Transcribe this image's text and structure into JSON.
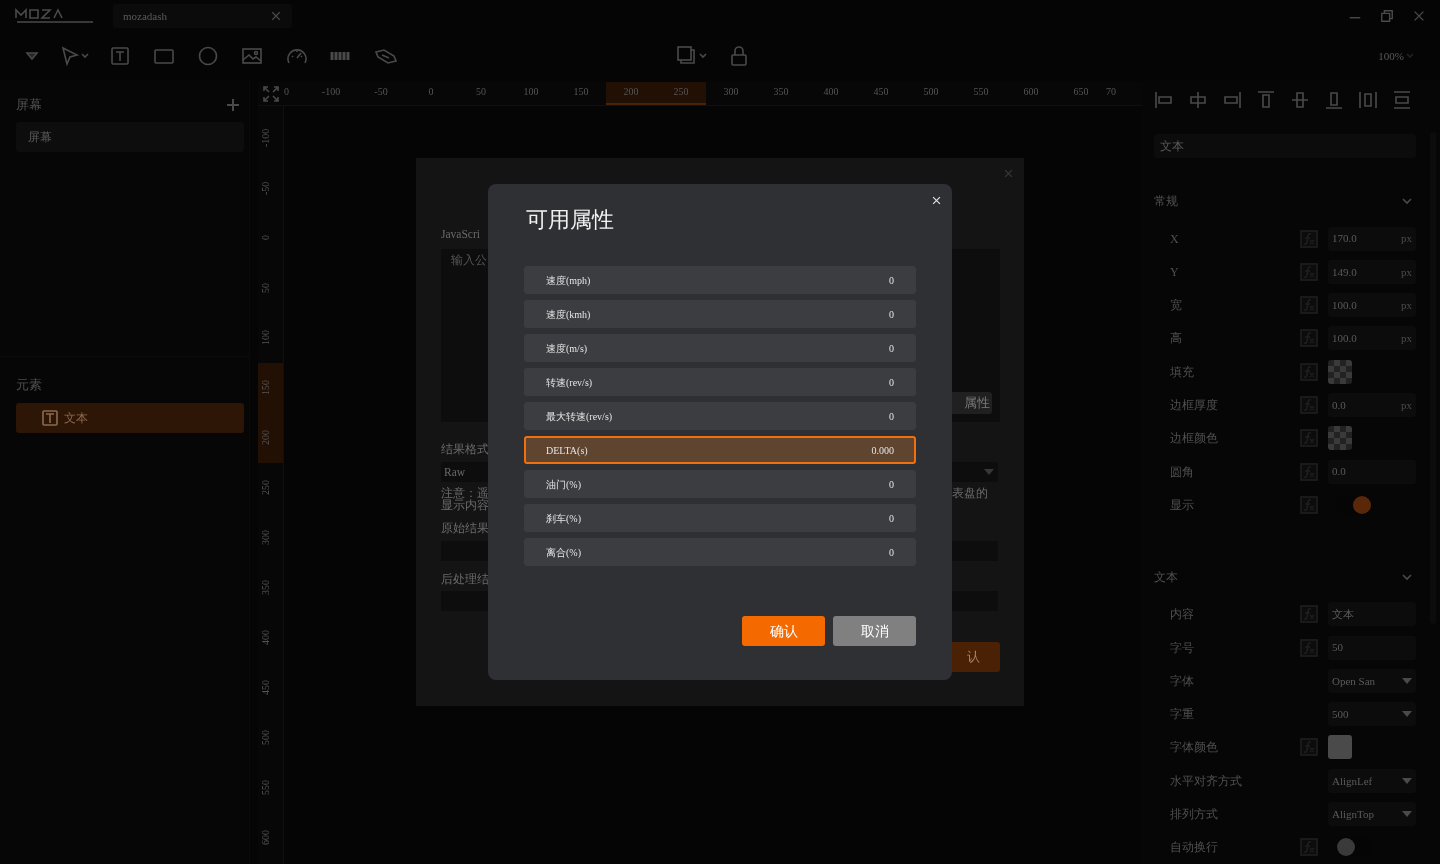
{
  "title_bar": {
    "tab": "mozadash"
  },
  "toolbar": {
    "zoom": "100%"
  },
  "screens_panel": {
    "title": "屏幕",
    "items": [
      {
        "label": "屏幕",
        "selected": false
      }
    ]
  },
  "elements_panel": {
    "title": "元素",
    "items": [
      {
        "label": "文本",
        "selected": true
      }
    ]
  },
  "ruler": {
    "horizontal": [
      {
        "label": "0",
        "highlighted": false
      },
      {
        "label": "-100",
        "highlighted": false
      },
      {
        "label": "-50",
        "highlighted": false
      },
      {
        "label": "0",
        "highlighted": false
      },
      {
        "label": "50",
        "highlighted": false
      },
      {
        "label": "100",
        "highlighted": false
      },
      {
        "label": "150",
        "highlighted": false
      },
      {
        "label": "200",
        "highlighted": true
      },
      {
        "label": "250",
        "highlighted": true
      },
      {
        "label": "300",
        "highlighted": false
      },
      {
        "label": "350",
        "highlighted": false
      },
      {
        "label": "400",
        "highlighted": false
      },
      {
        "label": "450",
        "highlighted": false
      },
      {
        "label": "500",
        "highlighted": false
      },
      {
        "label": "550",
        "highlighted": false
      },
      {
        "label": "600",
        "highlighted": false
      },
      {
        "label": "650",
        "highlighted": false
      },
      {
        "label": "70",
        "highlighted": false
      }
    ],
    "vertical": [
      {
        "label": "-100",
        "highlighted": false
      },
      {
        "label": "-50",
        "highlighted": false
      },
      {
        "label": "0",
        "highlighted": false
      },
      {
        "label": "50",
        "highlighted": false
      },
      {
        "label": "100",
        "highlighted": false
      },
      {
        "label": "150",
        "highlighted": true
      },
      {
        "label": "200",
        "highlighted": true
      },
      {
        "label": "250",
        "highlighted": false
      },
      {
        "label": "300",
        "highlighted": false
      },
      {
        "label": "350",
        "highlighted": false
      },
      {
        "label": "400",
        "highlighted": false
      },
      {
        "label": "450",
        "highlighted": false
      },
      {
        "label": "500",
        "highlighted": false
      },
      {
        "label": "550",
        "highlighted": false
      },
      {
        "label": "600",
        "highlighted": false
      }
    ]
  },
  "properties": {
    "name": "文本",
    "sections": [
      {
        "title": "常规",
        "expanded": true,
        "rows": [
          {
            "label": "X",
            "kind": "number",
            "formula": true,
            "value": "170.0",
            "unit": "px"
          },
          {
            "label": "Y",
            "kind": "number",
            "formula": true,
            "value": "149.0",
            "unit": "px"
          },
          {
            "label": "宽",
            "kind": "number",
            "formula": true,
            "value": "100.0",
            "unit": "px"
          },
          {
            "label": "高",
            "kind": "number",
            "formula": true,
            "value": "100.0",
            "unit": "px"
          },
          {
            "label": "填充",
            "kind": "color",
            "formula": true,
            "transparent": true
          },
          {
            "label": "边框厚度",
            "kind": "number",
            "formula": true,
            "value": "0.0",
            "unit": "px"
          },
          {
            "label": "边框颜色",
            "kind": "color",
            "formula": true,
            "transparent": true
          },
          {
            "label": "圆角",
            "kind": "text",
            "formula": true,
            "value": "0.0"
          },
          {
            "label": "显示",
            "kind": "toggle",
            "formula": true,
            "on": true
          }
        ]
      },
      {
        "title": "文本",
        "expanded": true,
        "rows": [
          {
            "label": "内容",
            "kind": "text",
            "formula": true,
            "value": "文本"
          },
          {
            "label": "字号",
            "kind": "text",
            "formula": true,
            "value": "50"
          },
          {
            "label": "字体",
            "kind": "select",
            "formula": false,
            "value": "Open San"
          },
          {
            "label": "字重",
            "kind": "select",
            "formula": false,
            "value": "500"
          },
          {
            "label": "字体颜色",
            "kind": "color",
            "formula": true,
            "transparent": false
          },
          {
            "label": "水平对齐方式",
            "kind": "select",
            "formula": false,
            "value": "AlignLef"
          },
          {
            "label": "排列方式",
            "kind": "select",
            "formula": false,
            "value": "AlignTop"
          },
          {
            "label": "自动换行",
            "kind": "toggle",
            "formula": true,
            "on": false
          }
        ]
      }
    ]
  },
  "expression_dialog": {
    "left": {
      "code_label": "JavaScri",
      "code_placeholder": "输入公",
      "format_label": "结果格式",
      "format_value": "Raw",
      "note_lines": [
        "注意：遥",
        "显示内容"
      ],
      "raw_label": "原始结果",
      "processed_label": "后处理结"
    },
    "right": {
      "properties_button": "属性",
      "note": "表盘的",
      "confirm_button": "认"
    }
  },
  "properties_dialog": {
    "title": "可用属性",
    "items": [
      {
        "name": "速度(mph)",
        "value": "0",
        "selected": false
      },
      {
        "name": "速度(kmh)",
        "value": "0",
        "selected": false
      },
      {
        "name": "速度(m/s)",
        "value": "0",
        "selected": false
      },
      {
        "name": "转速(rev/s)",
        "value": "0",
        "selected": false
      },
      {
        "name": "最大转速(rev/s)",
        "value": "0",
        "selected": false
      },
      {
        "name": "DELTA(s)",
        "value": "0.000",
        "selected": true
      },
      {
        "name": "油门(%)",
        "value": "0",
        "selected": false
      },
      {
        "name": "刹车(%)",
        "value": "0",
        "selected": false
      },
      {
        "name": "离合(%)",
        "value": "0",
        "selected": false
      }
    ],
    "buttons": [
      {
        "label": "确认",
        "kind": "primary"
      },
      {
        "label": "取消",
        "kind": "secondary"
      }
    ]
  }
}
